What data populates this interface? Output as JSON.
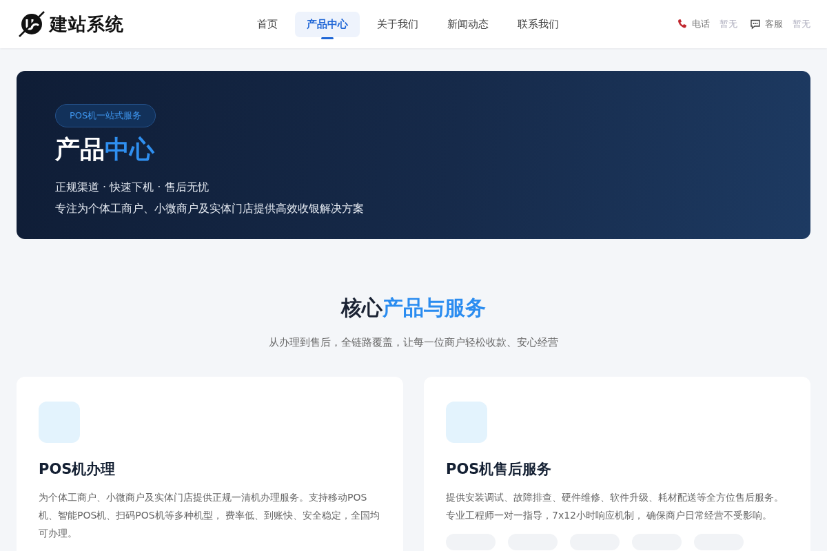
{
  "header": {
    "logo_text": "建站系统",
    "nav": [
      {
        "label": "首页",
        "selected": false
      },
      {
        "label": "产品中心",
        "selected": true
      },
      {
        "label": "关于我们",
        "selected": false
      },
      {
        "label": "新闻动态",
        "selected": false
      },
      {
        "label": "联系我们",
        "selected": false
      }
    ],
    "contacts": [
      {
        "kind": "phone",
        "label": "电话",
        "value": "暂无"
      },
      {
        "kind": "chat",
        "label": "客服",
        "value": "暂无"
      }
    ]
  },
  "hero": {
    "badge": "POS机一站式服务",
    "title_parts": [
      "产品",
      "中心"
    ],
    "tagline": "正规渠道 · 快速下机 · 售后无忧",
    "description": "专注为个体工商户、小微商户及实体门店提供高效收银解决方案"
  },
  "section": {
    "title_parts": [
      "核心",
      "产品与服务"
    ],
    "subtitle": "从办理到售后，全链路覆盖，让每一位商户轻松收款、安心经营",
    "cards": [
      {
        "title": "POS机办理",
        "description": "为个体工商户、小微商户及实体门店提供正规一清机办理服务。支持移动POS机、智能POS机、扫码POS机等多种机型， 费率低、到账快、安全稳定，全国均可办理。"
      },
      {
        "title": "POS机售后服务",
        "description": "提供安装调试、故障排查、硬件维修、软件升级、耗材配送等全方位售后服务。专业工程师一对一指导，7x12小时响应机制， 确保商户日常经营不受影响。"
      }
    ]
  }
}
